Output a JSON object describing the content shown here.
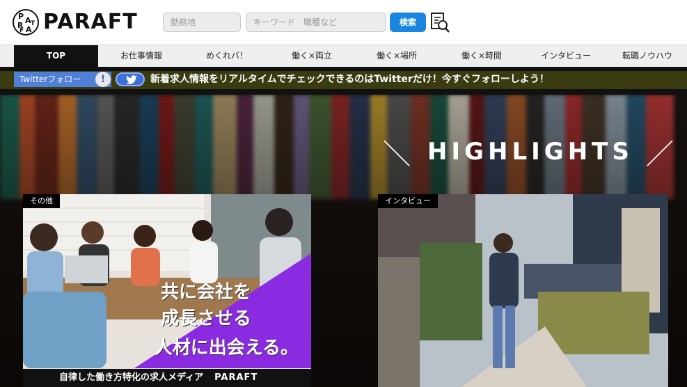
{
  "header": {
    "logo_text": "PARAFT",
    "logo_mark_letters": [
      "P",
      "A",
      "R",
      "A",
      "F",
      "T"
    ],
    "area_placeholder": "勤務地",
    "keyword_placeholder": "キーワード　職種など",
    "search_label": "検索",
    "detail_search_icon": "document-search-icon"
  },
  "nav": {
    "items": [
      {
        "label": "TOP",
        "active": true
      },
      {
        "label": "お仕事情報",
        "active": false
      },
      {
        "label": "めくれバ！",
        "active": false
      },
      {
        "label": "働く×両立",
        "active": false
      },
      {
        "label": "働く×場所",
        "active": false
      },
      {
        "label": "働く×時間",
        "active": false
      },
      {
        "label": "インタビュー",
        "active": false
      },
      {
        "label": "転職ノウハウ",
        "active": false
      }
    ]
  },
  "ticker": {
    "follow_label": "Twitterフォロー",
    "info_glyph": "!",
    "message": "新着求人情報をリアルタイムでチェックできるのはTwitterだけ！今すぐフォローしよう！"
  },
  "hero": {
    "title": "HIGHLIGHTS",
    "slash_left": "＼",
    "slash_right": "／"
  },
  "cards": [
    {
      "tag": "その他",
      "headline_lines": [
        "共に会社を",
        "成長させる",
        "人材に出会える。"
      ],
      "footer_text": "自律した働き方特化の求人メディア",
      "footer_brand": "PARAFT"
    },
    {
      "tag": "インタビュー"
    }
  ],
  "colors": {
    "accent_blue": "#1b86e0",
    "twitter_blue": "#4f7fd6",
    "ticker_bg": "#3b3b12",
    "banner_purple": "#8a2be2"
  }
}
